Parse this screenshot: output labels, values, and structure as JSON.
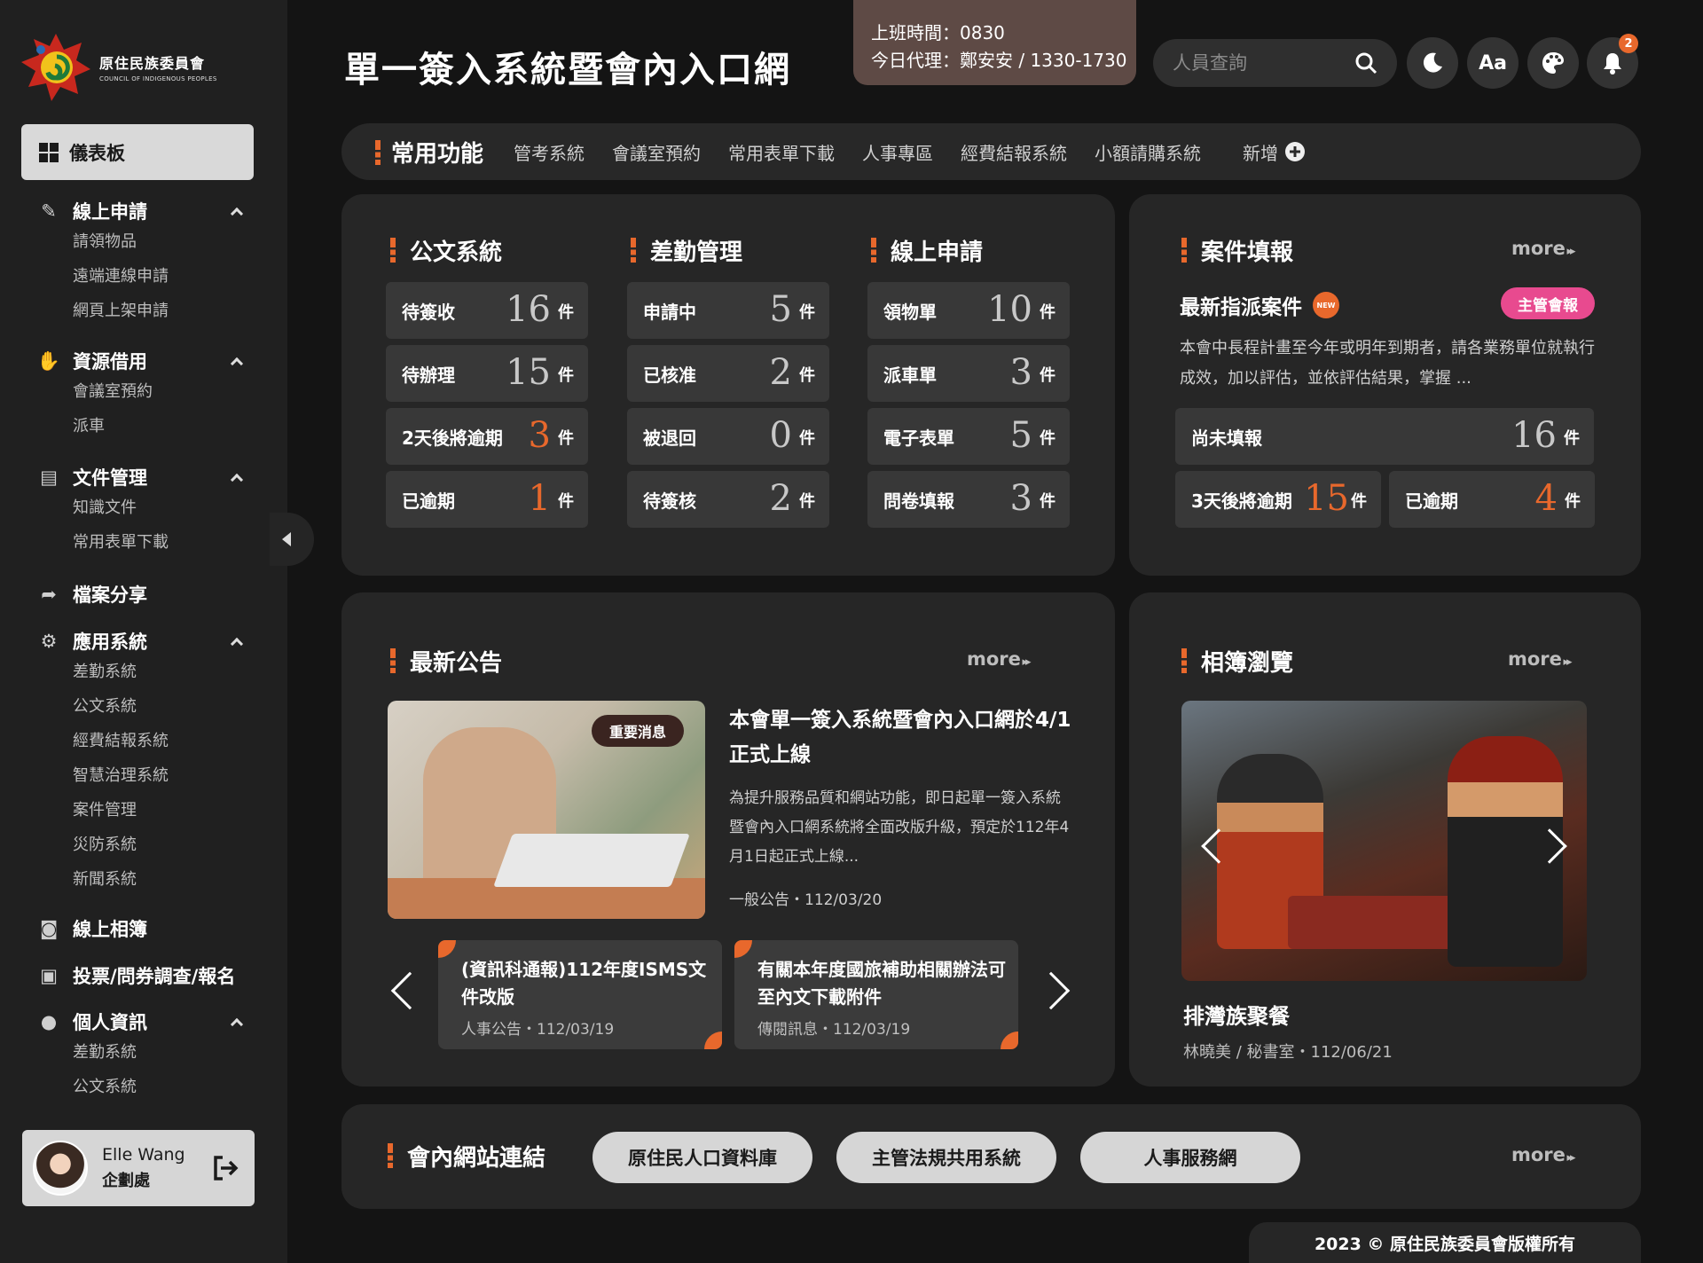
{
  "logo": {
    "name_zh": "原住民族委員會",
    "name_en": "COUNCIL OF INDIGENOUS PEOPLES"
  },
  "sidebar": {
    "active": "儀表板",
    "groups": [
      {
        "label": "線上申請",
        "icon": "edit-icon",
        "items": [
          "請領物品",
          "遠端連線申請",
          "網頁上架申請"
        ]
      },
      {
        "label": "資源借用",
        "icon": "hand-icon",
        "items": [
          "會議室預約",
          "派車"
        ]
      },
      {
        "label": "文件管理",
        "icon": "clipboard-icon",
        "items": [
          "知識文件",
          "常用表單下載"
        ]
      },
      {
        "label": "檔案分享",
        "icon": "share-icon",
        "items": []
      },
      {
        "label": "應用系統",
        "icon": "gear-icon",
        "items": [
          "差勤系統",
          "公文系統",
          "經費結報系統",
          "智慧治理系統",
          "案件管理",
          "災防系統",
          "新聞系統"
        ]
      },
      {
        "label": "線上相簿",
        "icon": "camera-icon",
        "items": []
      },
      {
        "label": "投票/問券調查/報名",
        "icon": "ballot-icon",
        "items": []
      },
      {
        "label": "個人資訊",
        "icon": "user-icon",
        "items": [
          "差勤系統",
          "公文系統"
        ]
      }
    ],
    "user": {
      "name": "Elle Wang",
      "dept": "企劃處"
    }
  },
  "header": {
    "title": "單一簽入系統暨會內入口網",
    "shift_line1": "上班時間：0830",
    "shift_line2": "今日代理：鄭安安 / 1330-1730",
    "search_placeholder": "人員查詢",
    "font_btn": "Aa",
    "notification_count": "2"
  },
  "quickbar": {
    "title": "常用功能",
    "items": [
      "管考系統",
      "會議室預約",
      "常用表單下載",
      "人事專區",
      "經費結報系統",
      "小額請購系統"
    ],
    "add_label": "新增"
  },
  "stats": {
    "doc": {
      "title": "公文系統",
      "rows": [
        {
          "label": "待簽收",
          "value": "16",
          "unit": "件",
          "hot": false
        },
        {
          "label": "待辦理",
          "value": "15",
          "unit": "件",
          "hot": false
        },
        {
          "label": "2天後將逾期",
          "value": "3",
          "unit": "件",
          "hot": true
        },
        {
          "label": "已逾期",
          "value": "1",
          "unit": "件",
          "hot": true
        }
      ]
    },
    "attend": {
      "title": "差勤管理",
      "rows": [
        {
          "label": "申請中",
          "value": "5",
          "unit": "件",
          "hot": false
        },
        {
          "label": "已核准",
          "value": "2",
          "unit": "件",
          "hot": false
        },
        {
          "label": "被退回",
          "value": "0",
          "unit": "件",
          "hot": false
        },
        {
          "label": "待簽核",
          "value": "2",
          "unit": "件",
          "hot": false
        }
      ]
    },
    "online": {
      "title": "線上申請",
      "rows": [
        {
          "label": "領物單",
          "value": "10",
          "unit": "件",
          "hot": false
        },
        {
          "label": "派車單",
          "value": "3",
          "unit": "件",
          "hot": false
        },
        {
          "label": "電子表單",
          "value": "5",
          "unit": "件",
          "hot": false
        },
        {
          "label": "問卷填報",
          "value": "3",
          "unit": "件",
          "hot": false
        }
      ]
    }
  },
  "cases": {
    "title": "案件填報",
    "more": "more",
    "subtitle": "最新指派案件",
    "new_badge": "NEW",
    "tag": "主管會報",
    "desc": "本會中長程計畫至今年或明年到期者，請各業務單位就執行成效，加以評估，並依評估結果，掌握 ...",
    "pending": {
      "label": "尚未填報",
      "value": "16",
      "unit": "件"
    },
    "due3": {
      "label": "3天後將逾期",
      "value": "15",
      "unit": "件"
    },
    "overdue": {
      "label": "已逾期",
      "value": "4",
      "unit": "件"
    }
  },
  "news": {
    "title": "最新公告",
    "more": "more",
    "image_tag": "重要消息",
    "headline": "本會單一簽入系統暨會內入口網於4/1正式上線",
    "body": "為提升服務品質和網站功能，即日起單一簽入系統暨會內入口網系統將全面改版升級，預定於112年4月1日起正式上線...",
    "meta": "一般公告・112/03/20",
    "cards": [
      {
        "title": "(資訊科通報)112年度ISMS文件改版",
        "meta": "人事公告・112/03/19"
      },
      {
        "title": "有關本年度國旅補助相關辦法可至內文下載附件",
        "meta": "傳閱訊息・112/03/19"
      }
    ]
  },
  "album": {
    "title": "相簿瀏覽",
    "more": "more",
    "photo_title": "排灣族聚餐",
    "photo_meta": "林曉美 / 秘書室・112/06/21"
  },
  "links": {
    "title": "會內網站連結",
    "items": [
      "原住民人口資料庫",
      "主管法規共用系統",
      "人事服務網"
    ],
    "more": "more"
  },
  "footer": "2023 © 原住民族委員會版權所有",
  "colors": {
    "accent": "#e8682c",
    "pink": "#e84a8f",
    "bg": "#141414",
    "panel": "#262626"
  }
}
